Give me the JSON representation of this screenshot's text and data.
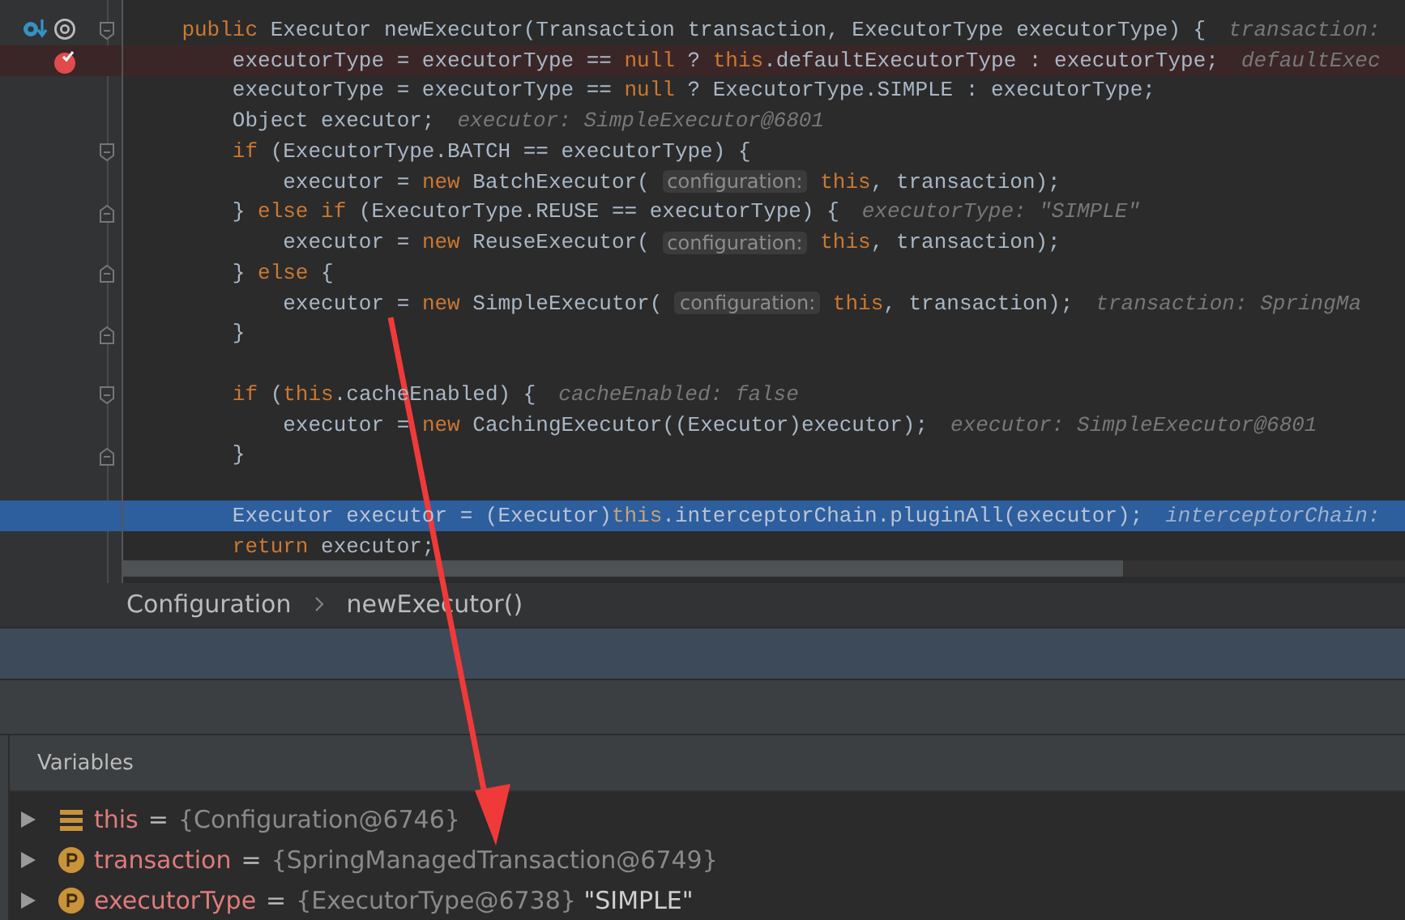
{
  "editor": {
    "lines": [
      {
        "kind": "fold-start",
        "breakpoint": false,
        "current": false,
        "tokens": [
          {
            "kind": "kw",
            "text": "    public"
          },
          {
            "kind": "text",
            "text": " Executor newExecutor(Transaction transaction, ExecutorType executorType) {"
          },
          {
            "kind": "value",
            "text": "transaction:"
          }
        ]
      },
      {
        "kind": "plain",
        "breakpoint": true,
        "current": false,
        "tokens": [
          {
            "kind": "text",
            "text": "        executorType = executorType == "
          },
          {
            "kind": "kw",
            "text": "null"
          },
          {
            "kind": "text",
            "text": " ? "
          },
          {
            "kind": "kw",
            "text": "this"
          },
          {
            "kind": "text",
            "text": ".defaultExecutorType : executorType;"
          },
          {
            "kind": "value",
            "text": "defaultExec"
          }
        ]
      },
      {
        "kind": "plain",
        "breakpoint": false,
        "current": false,
        "tokens": [
          {
            "kind": "text",
            "text": "        executorType = executorType == "
          },
          {
            "kind": "kw",
            "text": "null"
          },
          {
            "kind": "text",
            "text": " ? ExecutorType.SIMPLE : executorType;"
          }
        ]
      },
      {
        "kind": "plain",
        "breakpoint": false,
        "current": false,
        "tokens": [
          {
            "kind": "text",
            "text": "        Object executor;"
          },
          {
            "kind": "value",
            "text": "executor: SimpleExecutor@6801"
          }
        ]
      },
      {
        "kind": "fold-start",
        "breakpoint": false,
        "current": false,
        "tokens": [
          {
            "kind": "kw",
            "text": "        if"
          },
          {
            "kind": "text",
            "text": " (ExecutorType.BATCH == executorType) {"
          }
        ]
      },
      {
        "kind": "plain",
        "breakpoint": false,
        "current": false,
        "tokens": [
          {
            "kind": "text",
            "text": "            executor = "
          },
          {
            "kind": "kw",
            "text": "new"
          },
          {
            "kind": "text",
            "text": " BatchExecutor( "
          },
          {
            "kind": "hint",
            "text": "configuration:"
          },
          {
            "kind": "kw",
            "text": " this"
          },
          {
            "kind": "text",
            "text": ", transaction);"
          }
        ]
      },
      {
        "kind": "fold-end",
        "breakpoint": false,
        "current": false,
        "tokens": [
          {
            "kind": "text",
            "text": "        } "
          },
          {
            "kind": "kw",
            "text": "else if"
          },
          {
            "kind": "text",
            "text": " (ExecutorType.REUSE == executorType) {"
          },
          {
            "kind": "value",
            "text": "executorType: \"SIMPLE\""
          }
        ]
      },
      {
        "kind": "plain",
        "breakpoint": false,
        "current": false,
        "tokens": [
          {
            "kind": "text",
            "text": "            executor = "
          },
          {
            "kind": "kw",
            "text": "new"
          },
          {
            "kind": "text",
            "text": " ReuseExecutor( "
          },
          {
            "kind": "hint",
            "text": "configuration:"
          },
          {
            "kind": "kw",
            "text": " this"
          },
          {
            "kind": "text",
            "text": ", transaction);"
          }
        ]
      },
      {
        "kind": "fold-end",
        "breakpoint": false,
        "current": false,
        "tokens": [
          {
            "kind": "text",
            "text": "        } "
          },
          {
            "kind": "kw",
            "text": "else"
          },
          {
            "kind": "text",
            "text": " {"
          }
        ]
      },
      {
        "kind": "plain",
        "breakpoint": false,
        "current": false,
        "tokens": [
          {
            "kind": "text",
            "text": "            executor = "
          },
          {
            "kind": "kw",
            "text": "new"
          },
          {
            "kind": "text",
            "text": " SimpleExecutor( "
          },
          {
            "kind": "hint",
            "text": "configuration:"
          },
          {
            "kind": "kw",
            "text": " this"
          },
          {
            "kind": "text",
            "text": ", transaction);"
          },
          {
            "kind": "value",
            "text": "transaction: SpringMa"
          }
        ]
      },
      {
        "kind": "fold-end",
        "breakpoint": false,
        "current": false,
        "tokens": [
          {
            "kind": "text",
            "text": "        }"
          }
        ]
      },
      {
        "kind": "plain",
        "breakpoint": false,
        "current": false
      },
      {
        "kind": "fold-start",
        "breakpoint": false,
        "current": false,
        "tokens": [
          {
            "kind": "kw",
            "text": "        if"
          },
          {
            "kind": "text",
            "text": " ("
          },
          {
            "kind": "kw",
            "text": "this"
          },
          {
            "kind": "text",
            "text": ".cacheEnabled) {"
          },
          {
            "kind": "value",
            "text": "cacheEnabled: false"
          }
        ]
      },
      {
        "kind": "plain",
        "breakpoint": false,
        "current": false,
        "tokens": [
          {
            "kind": "text",
            "text": "            executor = "
          },
          {
            "kind": "kw",
            "text": "new"
          },
          {
            "kind": "text",
            "text": " CachingExecutor((Executor)executor);"
          },
          {
            "kind": "value",
            "text": "executor: SimpleExecutor@6801"
          }
        ]
      },
      {
        "kind": "fold-end",
        "breakpoint": false,
        "current": false,
        "tokens": [
          {
            "kind": "text",
            "text": "        }"
          }
        ]
      },
      {
        "kind": "plain",
        "breakpoint": false,
        "current": false
      },
      {
        "kind": "plain",
        "breakpoint": false,
        "current": true,
        "tokens": [
          {
            "kind": "text",
            "text": "        Executor executor = (Executor)"
          },
          {
            "kind": "kw",
            "text": "this"
          },
          {
            "kind": "text",
            "text": ".interceptorChain.pluginAll(executor);"
          },
          {
            "kind": "value",
            "text": "interceptorChain:"
          }
        ]
      },
      {
        "kind": "plain",
        "breakpoint": false,
        "current": false,
        "tokens": [
          {
            "kind": "kw",
            "text": "        return"
          },
          {
            "kind": "text",
            "text": " executor;"
          }
        ]
      }
    ]
  },
  "breadcrumb": [
    "Configuration",
    "newExecutor()"
  ],
  "variables": {
    "title": "Variables",
    "rows": [
      {
        "kind": "static",
        "name": "this",
        "operator": "=",
        "value": "{Configuration@6746}"
      },
      {
        "kind": "parameter",
        "name": "transaction",
        "operator": "=",
        "value": "{SpringManagedTransaction@6749}"
      },
      {
        "kind": "parameter",
        "name": "executorType",
        "operator": "=",
        "value": "{ExecutorType@6738}",
        "string": "\"SIMPLE\""
      }
    ]
  }
}
